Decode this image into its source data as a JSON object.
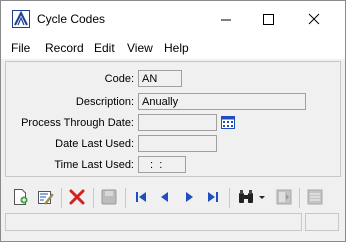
{
  "window": {
    "title": "Cycle Codes"
  },
  "menu": {
    "items": [
      "File",
      "Record",
      "Edit",
      "View",
      "Help"
    ]
  },
  "form": {
    "code_label": "Code:",
    "code_value": "AN",
    "description_label": "Description:",
    "description_value": "Anually",
    "process_through_label": "Process Through Date:",
    "process_through_value": "",
    "date_last_used_label": "Date Last Used:",
    "date_last_used_value": "",
    "time_last_used_label": "Time Last Used:",
    "time_last_used_value": " :  :"
  },
  "colors": {
    "accent": "#1f4fbf",
    "delete": "#d42020",
    "panel": "#f0f0f0"
  },
  "toolbar": {
    "icons": [
      "new-record-icon",
      "edit-record-icon",
      "delete-icon",
      "save-icon",
      "first-record-icon",
      "previous-record-icon",
      "next-record-icon",
      "last-record-icon",
      "find-icon",
      "find-dropdown-icon",
      "report-icon",
      "list-icon"
    ]
  }
}
